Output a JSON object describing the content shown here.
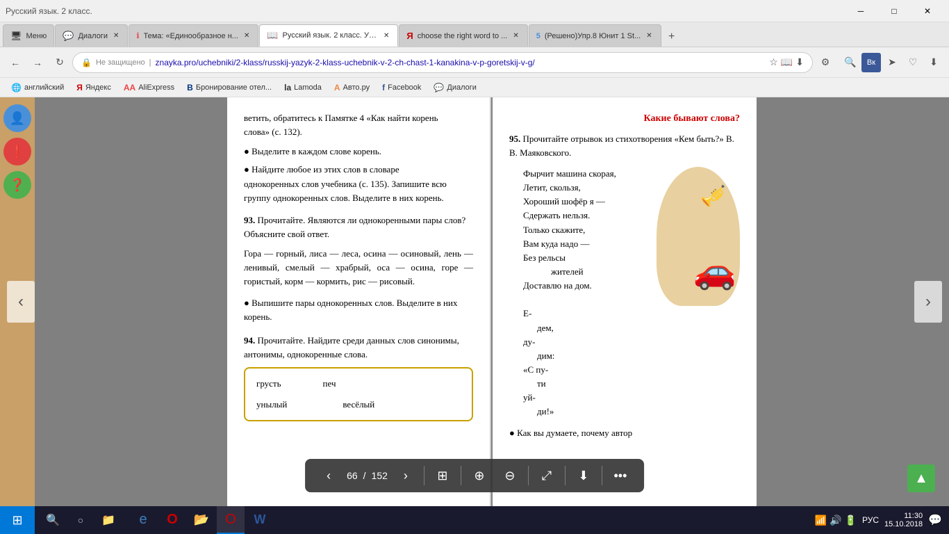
{
  "browser": {
    "title": "Русский язык. 2 класс.",
    "window_controls": {
      "minimize": "─",
      "maximize": "□",
      "close": "✕"
    }
  },
  "tabs": [
    {
      "id": 1,
      "favicon": "🖥",
      "title": "Меню",
      "active": false,
      "closable": false
    },
    {
      "id": 2,
      "favicon": "💬",
      "title": "Диалоги",
      "active": false,
      "closable": true
    },
    {
      "id": 3,
      "favicon": "ℹ",
      "title": "Тема: «Единообразное н...",
      "active": false,
      "closable": true
    },
    {
      "id": 4,
      "favicon": "📖",
      "title": "Русский язык. 2 класс. Уч...",
      "active": true,
      "closable": true
    },
    {
      "id": 5,
      "favicon": "Я",
      "title": "choose the right word to ...",
      "active": false,
      "closable": true
    },
    {
      "id": 6,
      "favicon": "5",
      "title": "(Решено)Упр.8 Юнит 1 St...",
      "active": false,
      "closable": true
    }
  ],
  "navbar": {
    "back_disabled": false,
    "forward_disabled": false,
    "address": "znayka.pro/uchebniki/2-klass/russkij-yazyk-2-klass-uchebnik-v-2-ch-chast-1-kanakina-v-p-goretskij-v-g/",
    "lock_text": "Не защищено",
    "search_placeholder": "Поиск"
  },
  "bookmarks": [
    {
      "label": "английский",
      "icon": "🌐"
    },
    {
      "label": "Яндекс",
      "icon": "Я"
    },
    {
      "label": "AliExpress",
      "icon": "🅰"
    },
    {
      "label": "Бронирование отел...",
      "icon": "В"
    },
    {
      "label": "Lamoda",
      "icon": "L"
    },
    {
      "label": "Авто.ру",
      "icon": "А"
    },
    {
      "label": "Facebook",
      "icon": "f"
    },
    {
      "label": "Диалоги",
      "icon": "💬"
    }
  ],
  "left_page": {
    "intro_text": "ветить, обратитесь к Памятке 4 «Как найти корень слова» (с. 132).",
    "bullet1": "Выделите в каждом слове корень.",
    "bullet2": "Найдите любое из этих слов в словаре однокоренных слов учебника (с. 135). Запишите всю группу однокоренных слов. Выделите в них корень.",
    "ex93_num": "93.",
    "ex93_text": "Прочитайте. Являются ли однокоренными пары слов? Объясните свой ответ.",
    "ex93_words": "Гора — горный, лиса — леса, осина — осиновый, лень — ленивый, смелый — храбрый, оса — осина, горе — гористый, корм — кормить, рис — рисовый.",
    "bullet3": "Выпишите пары однокоренных слов. Выделите в них корень.",
    "ex94_num": "94.",
    "ex94_text": "Прочитайте. Найдите среди данных слов синонимы, антонимы, однокоренные слова.",
    "word1": "грусть",
    "word2": "печ",
    "word3": "унылый",
    "word4": "весёлый"
  },
  "right_page": {
    "header": "Какие   бывают   слова?",
    "ex95_num": "95.",
    "ex95_text": "Прочитайте отрывок из стихотворения «Кем быть?» В. В. Маяковского.",
    "poem_lines": [
      "Фырчит машина скорая,",
      "Летит, скользя,",
      "Хороший шофёр я —",
      "Сдержать нельзя.",
      "Только скажите,",
      "Вам куда надо —",
      "Без рельсы",
      "        жителей",
      "Доставлю на дом.",
      "",
      "Е-",
      "    дем,",
      "ду-",
      "    дим:",
      "«С пу-",
      "    ти",
      "уй-",
      "    ди!»"
    ],
    "bottom_text": "• Как вы  думаете, почему автор"
  },
  "pdf_toolbar": {
    "prev_page": "‹",
    "page_current": "66",
    "page_total": "152",
    "next_page": "›",
    "grid_icon": "⊞",
    "zoom_in": "+",
    "zoom_out": "−",
    "fullscreen": "⤢",
    "download": "⬇",
    "more": "•••"
  },
  "taskbar": {
    "start_icon": "⊞",
    "search_icon": "🔍",
    "time": "11:30",
    "date": "15.10.2018",
    "lang": "РУС"
  },
  "side_icons": [
    {
      "type": "blue",
      "icon": "👤"
    },
    {
      "type": "red",
      "icon": "❗"
    },
    {
      "type": "green",
      "icon": "❓"
    }
  ]
}
